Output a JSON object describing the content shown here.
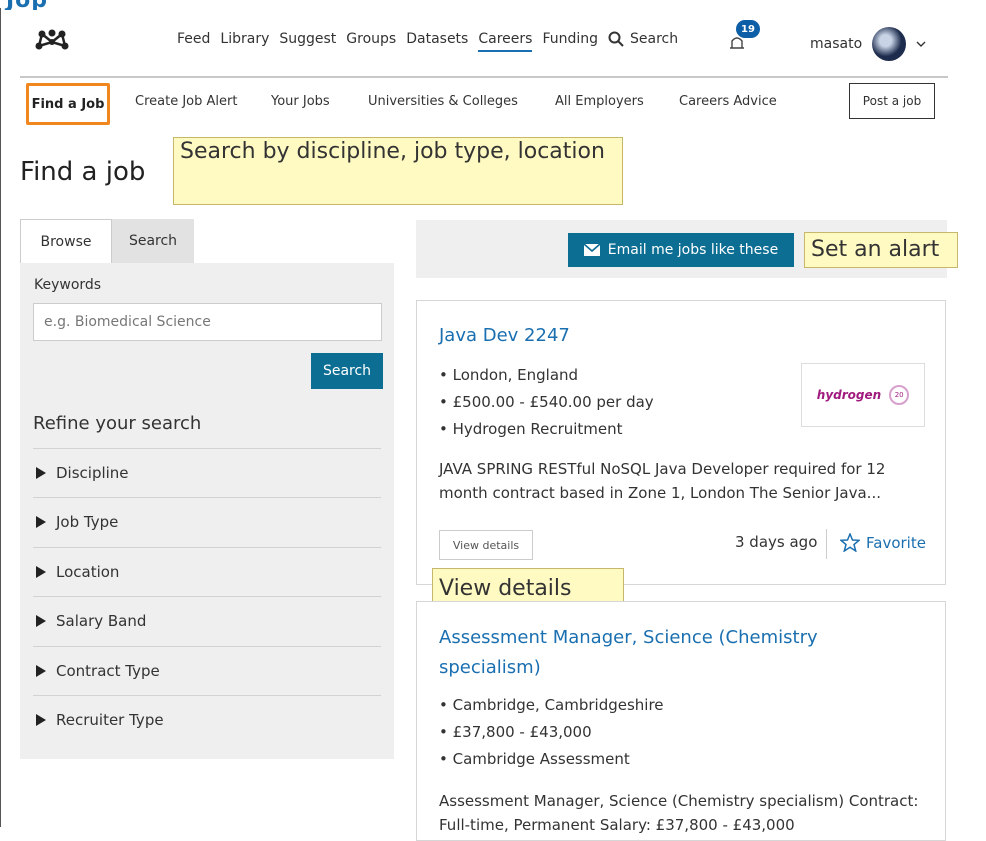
{
  "header_cut_text": "Jop",
  "nav": {
    "items": [
      "Feed",
      "Library",
      "Suggest",
      "Groups",
      "Datasets",
      "Careers",
      "Funding"
    ],
    "search_label": "Search",
    "notifications_count": "19",
    "username": "masato"
  },
  "subnav": {
    "items": [
      "Find a Job",
      "Create Job Alert",
      "Your Jobs",
      "Universities & Colleges",
      "All Employers",
      "Careers Advice"
    ],
    "post_job": "Post a job"
  },
  "page_title": "Find a job",
  "annotations": {
    "search_tip": "Search by discipline, job type, location",
    "alert_tip": "Set an alart",
    "view_tip": "View details"
  },
  "sidebar": {
    "tabs": [
      "Browse",
      "Search"
    ],
    "keywords_label": "Keywords",
    "keywords_placeholder": "e.g. Biomedical Science",
    "search_button": "Search",
    "refine_title": "Refine your search",
    "facets": [
      "Discipline",
      "Job Type",
      "Location",
      "Salary Band",
      "Contract Type",
      "Recruiter Type"
    ]
  },
  "alert": {
    "email_button": "Email me jobs like these"
  },
  "jobs": [
    {
      "title": "Java Dev 2247",
      "location": "London, England",
      "salary": "£500.00 - £540.00 per day",
      "employer": "Hydrogen Recruitment",
      "logo_text": "hydrogen",
      "logo_badge": "20",
      "description": "JAVA SPRING RESTful NoSQL Java Developer required for 12 month contract based in Zone 1, London The Senior Java...",
      "view_button": "View details",
      "posted": "3 days ago",
      "favorite": "Favorite"
    },
    {
      "title": "Assessment Manager, Science (Chemistry specialism)",
      "location": "Cambridge, Cambridgeshire",
      "salary": "£37,800 - £43,000",
      "employer": "Cambridge Assessment",
      "description": "Assessment Manager, Science (Chemistry specialism) Contract: Full-time, Permanent Salary: £37,800 - £43,000"
    }
  ],
  "colors": {
    "accent": "#1a6fb0",
    "button": "#0d6e94",
    "highlight": "#f0861e",
    "tooltip": "#fff9c2"
  }
}
